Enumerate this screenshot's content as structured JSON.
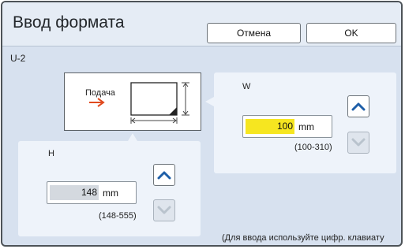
{
  "header": {
    "title": "Ввод формата",
    "cancel_label": "Отмена",
    "ok_label": "OK"
  },
  "format_code": "U-2",
  "diagram": {
    "feed_label": "Подача"
  },
  "width": {
    "label": "W",
    "value": "100",
    "unit": "mm",
    "range": "(100-310)"
  },
  "height": {
    "label": "H",
    "value": "148",
    "unit": "mm",
    "range": "(148-555)"
  },
  "hint": "(Для ввода используйте цифр. клавиату",
  "colors": {
    "active_field": "#f6e620",
    "inactive_field": "#d4d9df",
    "arrow": "#e04a1f",
    "stepper_icon": "#1f5fa8"
  }
}
